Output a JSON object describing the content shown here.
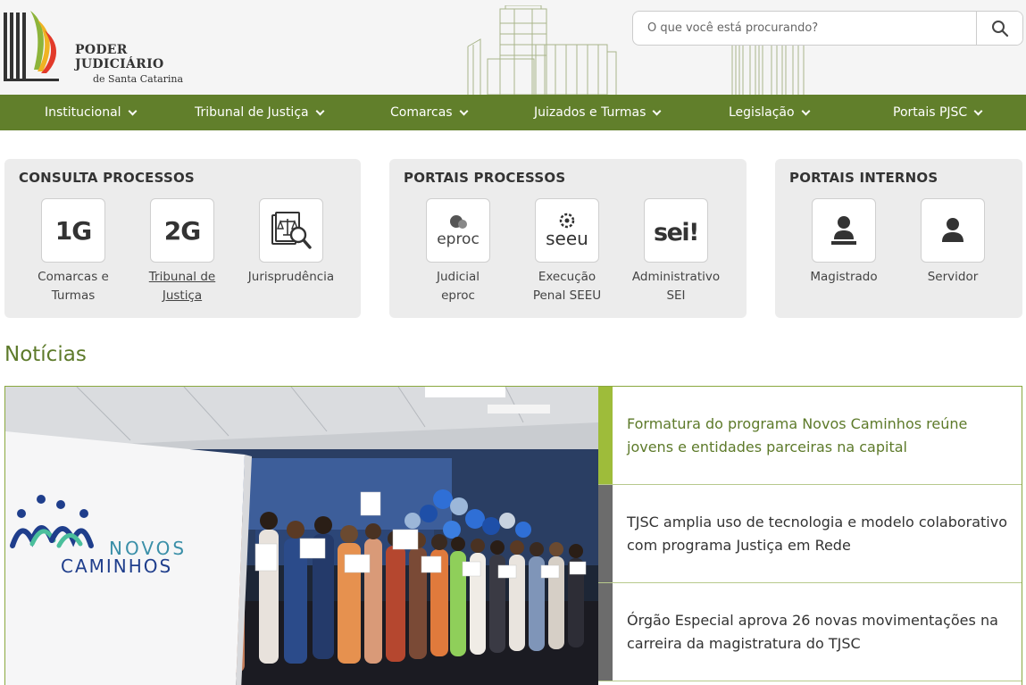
{
  "header": {
    "logo_title": "PODER JUDICIÁRIO",
    "logo_subtitle": "de Santa Catarina",
    "search_placeholder": "O que você está procurando?"
  },
  "nav": [
    {
      "label": "Institucional"
    },
    {
      "label": "Tribunal de Justiça"
    },
    {
      "label": "Comarcas"
    },
    {
      "label": "Juizados e Turmas"
    },
    {
      "label": "Legislação"
    },
    {
      "label": "Portais PJSC"
    }
  ],
  "panels": {
    "consulta": {
      "title": "CONSULTA PROCESSOS",
      "tiles": [
        {
          "icon_text": "1G",
          "line1": "Comarcas e",
          "line2": "Turmas"
        },
        {
          "icon_text": "2G",
          "line1": "Tribunal de",
          "line2": "Justiça"
        },
        {
          "icon": "jurisprudence-icon",
          "line1": "Jurisprudência"
        }
      ]
    },
    "portais_processos": {
      "title": "PORTAIS PROCESSOS",
      "tiles": [
        {
          "icon_text": "eproc",
          "line1": "Judicial",
          "line2": "eproc"
        },
        {
          "icon_text": "seeu",
          "line1": "Execução",
          "line2": "Penal SEEU"
        },
        {
          "icon_text": "sei!",
          "line1": "Administrativo",
          "line2": "SEI"
        }
      ]
    },
    "portais_internos": {
      "title": "PORTAIS INTERNOS",
      "tiles": [
        {
          "icon": "magistrate-icon",
          "line1": "Magistrado"
        },
        {
          "icon": "user-icon",
          "line1": "Servidor"
        }
      ]
    }
  },
  "news": {
    "title": "Notícias",
    "photo_text": {
      "brand_line1": "NOVOS",
      "brand_line2": "CAMINHOS"
    },
    "items": [
      {
        "text": "Formatura do programa Novos Caminhos reúne jovens e entidades parceiras na capital"
      },
      {
        "text": "TJSC amplia uso de tecnologia e modelo colaborativo com programa Justiça em Rede"
      },
      {
        "text": "Órgão Especial aprova 26 novas movimentações na carreira da magistratura do TJSC"
      }
    ]
  },
  "colors": {
    "nav_green": "#617f2b",
    "accent_green": "#9ebc3a",
    "title_green": "#5d7a2a"
  }
}
